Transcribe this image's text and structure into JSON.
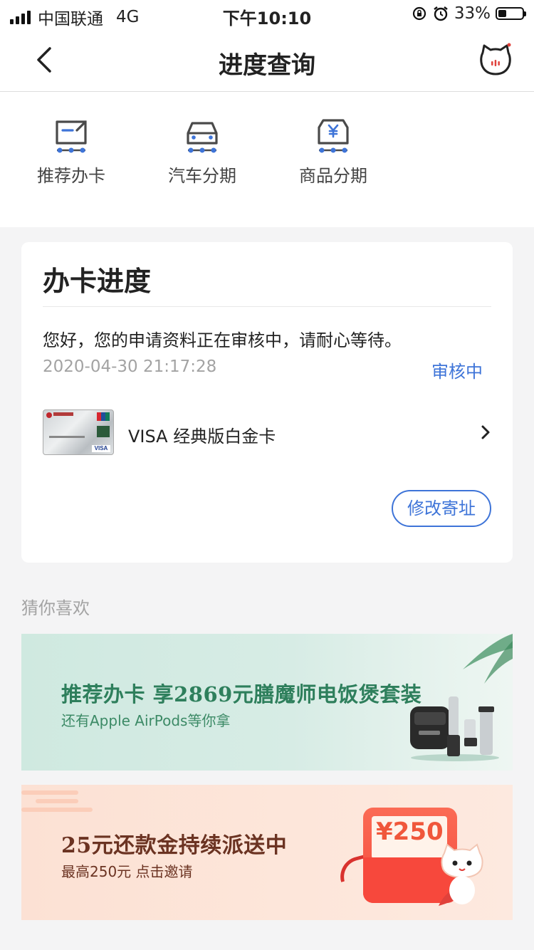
{
  "status_bar": {
    "carrier": "中国联通",
    "network": "4G",
    "time": "下午10:10",
    "battery_percent": "33%",
    "battery_level": 0.33
  },
  "nav": {
    "title": "进度查询",
    "back_icon": "chevron-left-icon",
    "mascot_icon": "cat-mascot-icon"
  },
  "quick_menu": [
    {
      "label": "推荐办卡",
      "icon": "share-card-icon"
    },
    {
      "label": "汽车分期",
      "icon": "car-icon"
    },
    {
      "label": "商品分期",
      "icon": "yen-box-icon"
    }
  ],
  "progress_card": {
    "title": "办卡进度",
    "message": "您好，您的申请资料正在审核中，请耐心等待。",
    "date": "2020-04-30 21:17:28",
    "status": "审核中",
    "card_name": "VISA 经典版白金卡",
    "card_brand": "VISA",
    "address_button": "修改寄址"
  },
  "recommend": {
    "section_title": "猜你喜欢",
    "banners": [
      {
        "title": "推荐办卡 享2869元膳魔师电饭煲套装",
        "subtitle": "还有Apple AirPods等你拿"
      },
      {
        "title": "25元还款金持续派送中",
        "subtitle": "最高250元 点击邀请",
        "badge_amount": "¥250"
      }
    ]
  },
  "colors": {
    "accent": "#3e74d8",
    "icon_blue": "#3e74d8",
    "banner_green": "#2e7f5c",
    "banner_brown": "#6b3322"
  }
}
